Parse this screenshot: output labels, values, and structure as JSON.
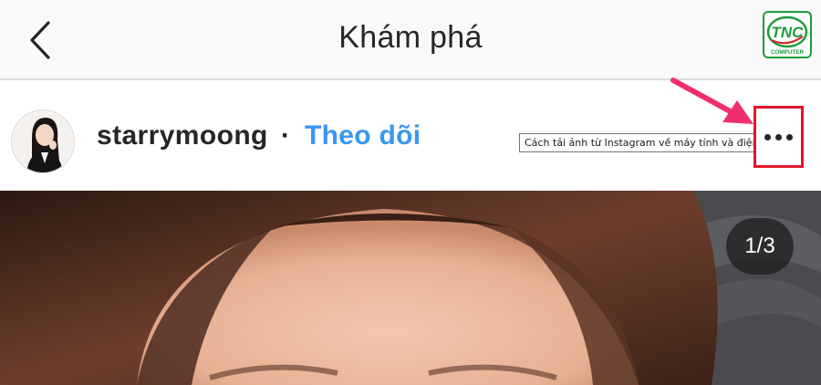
{
  "header": {
    "title": "Khám phá",
    "back_icon": "chevron-left-icon"
  },
  "logo": {
    "text": "TNC",
    "subtext": "COMPUTER",
    "color": "#1f9a3b"
  },
  "post": {
    "username": "starrymoong",
    "separator": "·",
    "follow_label": "Theo dõi",
    "more_icon": "more-horizontal-icon",
    "image_counter": "1/3"
  },
  "tooltip": {
    "text": "Cách tải ảnh từ Instagram về máy tính và điện thoại"
  },
  "colors": {
    "follow_blue": "#3897f0",
    "highlight_red": "#e4152c",
    "arrow_pink": "#f0306e",
    "text_dark": "#262626"
  }
}
